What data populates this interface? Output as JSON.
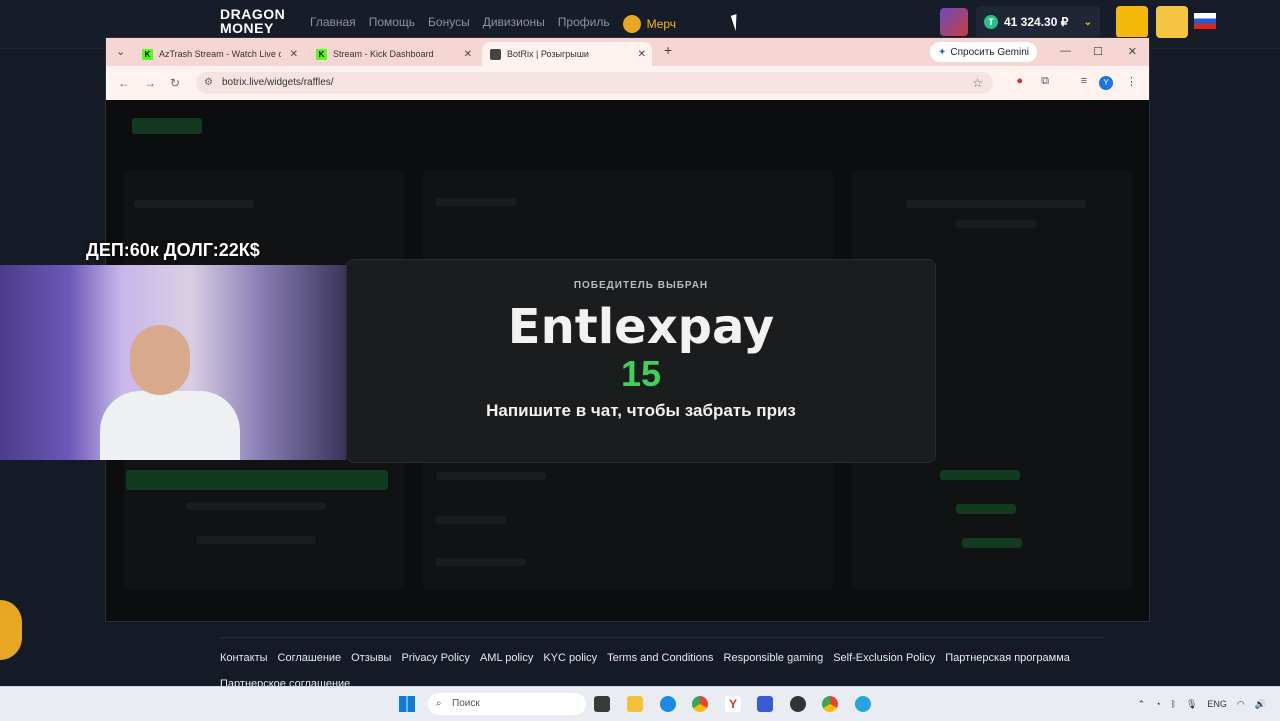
{
  "site": {
    "logo_line1": "DRAGON",
    "logo_line2": "MONEY",
    "nav": [
      "Главная",
      "Помощь",
      "Бонусы",
      "Дивизионы",
      "Профиль"
    ],
    "merch": "Мерч",
    "balance": "41 324.30 ₽",
    "coin_symbol": "T"
  },
  "browser": {
    "tabs": [
      {
        "title": "AzTrash Stream - Watch Live on",
        "icon": "kick-icon"
      },
      {
        "title": "Stream - Kick Dashboard",
        "icon": "kick-icon"
      },
      {
        "title": "BotRix | Розыгрыши",
        "icon": "botrix-icon"
      }
    ],
    "ask_gemini": "Спросить Gemini",
    "url": "botrix.live/widgets/raffles/",
    "profile_letter": "Y"
  },
  "winner": {
    "label": "ПОБЕДИТЕЛЬ ВЫБРАН",
    "name": "Entlexpay",
    "countdown": "15",
    "hint": "Напишите в чат, чтобы забрать приз"
  },
  "overlay": {
    "deposit_debt": "ДЕП:60к ДОЛГ:22К$"
  },
  "footer": {
    "links": [
      "Контакты",
      "Соглашение",
      "Отзывы",
      "Privacy Policy",
      "AML policy",
      "KYC policy",
      "Terms and Conditions",
      "Responsible gaming",
      "Self-Exclusion Policy",
      "Партнерская программа",
      "Партнерское соглашение"
    ]
  },
  "taskbar": {
    "search_placeholder": "Поиск",
    "language": "ENG"
  },
  "colors": {
    "accent_yellow": "#f5b90c",
    "winner_green": "#3fcf5a",
    "site_bg": "#141a26",
    "tabbar_bg": "#f6d6d2"
  }
}
